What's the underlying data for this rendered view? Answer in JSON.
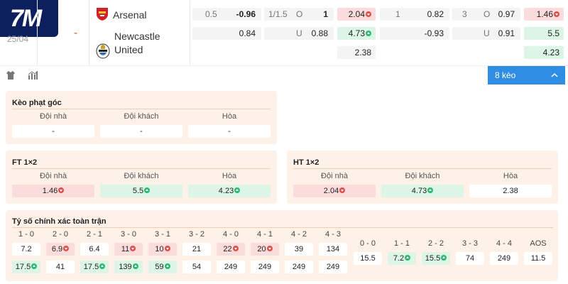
{
  "brand": {
    "logo_text": "7M"
  },
  "match": {
    "date": "25/04",
    "score": "-",
    "home": "Arsenal",
    "away_line1": "Newcastle",
    "away_line2": "United",
    "ft_handicap": {
      "home_line": "0.5",
      "home_odds": "-0.96",
      "away_odds": "0.84"
    },
    "ft_ou": {
      "line": "1/1.5",
      "over_label": "O",
      "over_odds": "1",
      "under_label": "U",
      "under_odds": "0.88"
    },
    "ft_1x2": {
      "home": "2.04",
      "away": "4.73",
      "draw": "2.38"
    },
    "h1_handicap": {
      "home_line": "1",
      "home_odds": "0.82",
      "away_odds": "-0.93"
    },
    "h1_ou": {
      "line": "3",
      "over_label": "O",
      "over_odds": "0.97",
      "under_label": "U",
      "under_odds": "0.91"
    },
    "h1_1x2": {
      "home": "1.46",
      "away": "5.5",
      "draw": "4.23"
    }
  },
  "toolbar": {
    "keo_label": "8 kèo",
    "jersey_icon": "jersey-icon",
    "stats_icon": "bar-chart-icon"
  },
  "corner": {
    "title": "Kèo phạt góc",
    "headers": [
      "Đội nhà",
      "Đội khách",
      "Hòa"
    ],
    "values": [
      "-",
      "-",
      "-"
    ]
  },
  "ft": {
    "title": "FT 1×2",
    "headers": [
      "Đội nhà",
      "Đội khách",
      "Hòa"
    ],
    "values": [
      "1.46",
      "5.5",
      "4.23"
    ]
  },
  "ht": {
    "title": "HT 1×2",
    "headers": [
      "Đội nhà",
      "Đội khách",
      "Hòa"
    ],
    "values": [
      "2.04",
      "4.73",
      "2.38"
    ]
  },
  "correct_score": {
    "title": "Tỷ số chính xác toàn trận",
    "left_headers": [
      "1 - 0",
      "2 - 0",
      "2 - 1",
      "3 - 0",
      "3 - 1",
      "3 - 2",
      "4 - 0",
      "4 - 1",
      "4 - 2",
      "4 - 3"
    ],
    "left_row1": [
      "7.2",
      "6.9",
      "6.4",
      "11",
      "10",
      "21",
      "22",
      "20",
      "39",
      "134"
    ],
    "left_row2": [
      "17.5",
      "41",
      "17.5",
      "139",
      "59",
      "54",
      "249",
      "249",
      "249",
      "249"
    ],
    "right_headers": [
      "0 - 0",
      "1 - 1",
      "2 - 2",
      "3 - 3",
      "4 - 4",
      "AOS"
    ],
    "right_row": [
      "15.5",
      "7.2",
      "15.5",
      "74",
      "249",
      "11.5"
    ]
  },
  "colors": {
    "up": "#2eb872",
    "down": "#d9534f",
    "accent": "#2f8de4",
    "panel": "#fdf1e8",
    "logo_bg": "#0d1f5c"
  }
}
